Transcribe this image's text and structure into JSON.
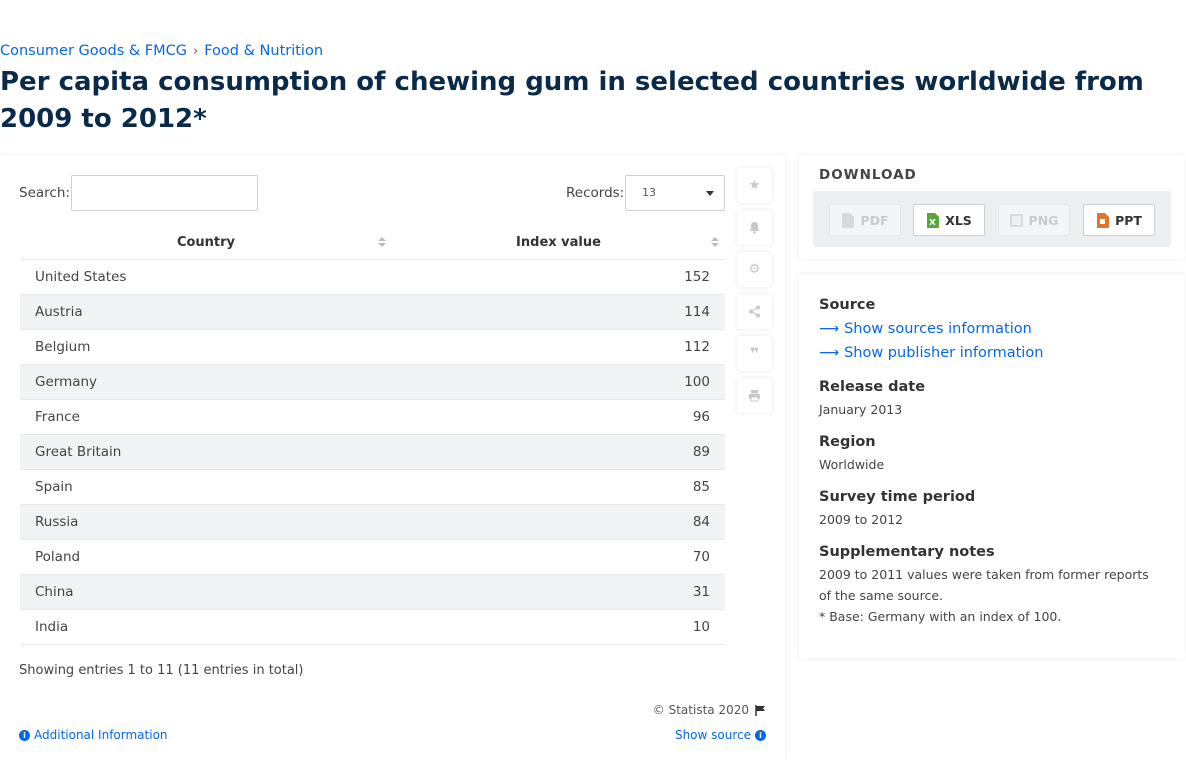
{
  "breadcrumb": {
    "items": [
      "Consumer Goods & FMCG",
      "Food & Nutrition"
    ],
    "separator": "›"
  },
  "page_title": "Per capita consumption of chewing gum in selected countries worldwide from 2009 to 2012*",
  "controls": {
    "search_label": "Search:",
    "records_label": "Records:",
    "records_value": "13"
  },
  "table": {
    "headers": [
      "Country",
      "Index value"
    ],
    "rows": [
      [
        "United States",
        "152"
      ],
      [
        "Austria",
        "114"
      ],
      [
        "Belgium",
        "112"
      ],
      [
        "Germany",
        "100"
      ],
      [
        "France",
        "96"
      ],
      [
        "Great Britain",
        "89"
      ],
      [
        "Spain",
        "85"
      ],
      [
        "Russia",
        "84"
      ],
      [
        "Poland",
        "70"
      ],
      [
        "China",
        "31"
      ],
      [
        "India",
        "10"
      ]
    ]
  },
  "footer": {
    "showing": "Showing entries 1 to 11 (11 entries in total)",
    "copyright": "© Statista 2020",
    "additional_info": "Additional Information",
    "show_source": "Show source"
  },
  "toolbar_icons": [
    "star-icon",
    "bell-icon",
    "gear-icon",
    "share-icon",
    "quote-icon",
    "print-icon"
  ],
  "download": {
    "title": "DOWNLOAD",
    "buttons": [
      {
        "label": "PDF",
        "enabled": false
      },
      {
        "label": "XLS",
        "enabled": true
      },
      {
        "label": "PNG",
        "enabled": false
      },
      {
        "label": "PPT",
        "enabled": true
      }
    ]
  },
  "source_panel": {
    "source_heading": "Source",
    "show_sources": "Show sources information",
    "show_publisher": "Show publisher information",
    "release_heading": "Release date",
    "release_value": "January 2013",
    "region_heading": "Region",
    "region_value": "Worldwide",
    "survey_heading": "Survey time period",
    "survey_value": "2009 to 2012",
    "notes_heading": "Supplementary notes",
    "notes_line1": "2009 to 2011 values were taken from former reports of the same source.",
    "notes_line2": "* Base: Germany with an index of 100."
  },
  "colors": {
    "link": "#0666e5",
    "title": "#0a2a4a",
    "xls": "#59a63a",
    "ppt": "#e3742c"
  }
}
